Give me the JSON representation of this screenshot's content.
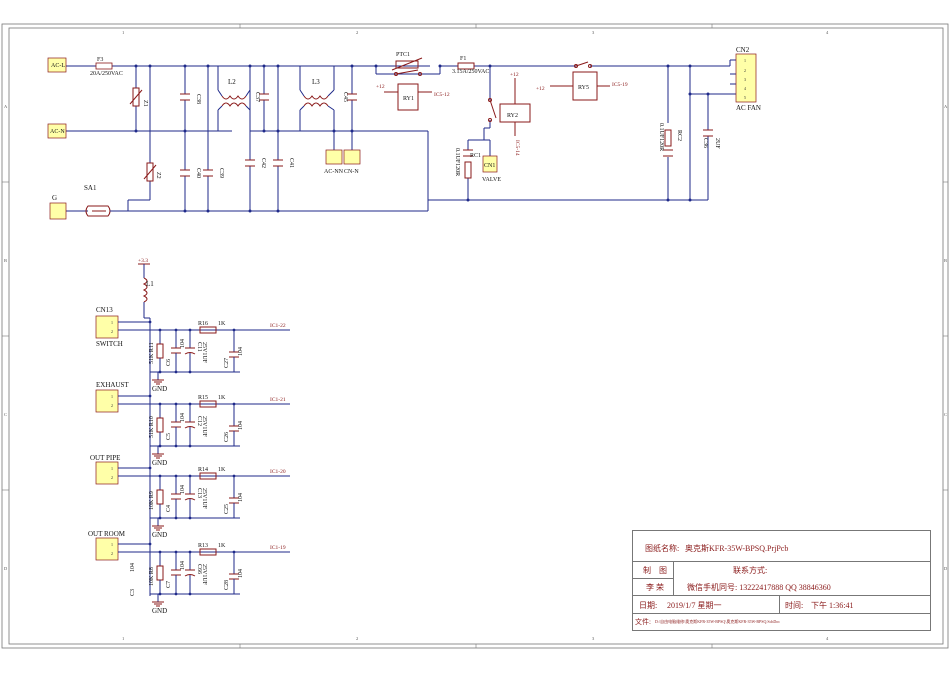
{
  "border": {
    "top_numbers": [
      "1",
      "2",
      "3",
      "4"
    ],
    "bottom_numbers": [
      "1",
      "2",
      "3",
      "4"
    ],
    "side_letters": [
      "A",
      "B",
      "C",
      "D"
    ]
  },
  "ac_section": {
    "terminals": {
      "ac_l": "AC-L",
      "ac_n": "AC-N",
      "g": "G"
    },
    "fuse_f3": {
      "ref": "F3",
      "value": "20A/250VAC"
    },
    "z1": "Z1",
    "z2": "Z2",
    "sa1": "SA1",
    "caps": {
      "c38": "C38",
      "c40": "C40",
      "c39": "C39",
      "c37": "C37",
      "c42": "C42",
      "c41": "C41",
      "c45": "C45"
    },
    "inductors": {
      "l2": "L2",
      "l3": "L3"
    },
    "out_terms": {
      "ac_nn": "AC-NN",
      "cn_n": "CN-N"
    },
    "ptc1": "PTC1",
    "fuse_f1": {
      "ref": "F1",
      "value": "3.15A/250VAC"
    },
    "ry1": {
      "ref": "RY1",
      "net": "IC5-12",
      "supply": "+12"
    },
    "ry2": {
      "ref": "RY2",
      "net": "IC5-14",
      "supply": "+12"
    },
    "ry5": {
      "ref": "RY5",
      "net": "IC5-19",
      "supply": "+12"
    },
    "rc1": {
      "ref": "RC1",
      "value": "0.1UF120R"
    },
    "cn1": {
      "ref": "CN1",
      "label": "VALVE"
    },
    "rc2": {
      "ref": "RC2",
      "value": "0.1UF120R"
    },
    "c36": {
      "ref": "C36",
      "value": "2UF"
    },
    "cn2": {
      "ref": "CN2",
      "label": "AC FAN",
      "pins": [
        "1",
        "2",
        "3",
        "4",
        "5"
      ]
    }
  },
  "input_section": {
    "supply": "+3.3",
    "l1": "L1",
    "gnd": "GND",
    "channels": [
      {
        "conn": "CN13",
        "name": "SWITCH",
        "pins": [
          "1",
          "2"
        ],
        "r_pull": "51K R11",
        "c_small": "C6",
        "c_small_val": "104",
        "c_elec": "C11",
        "c_elec_val": "25V1UF",
        "r_series": "R16",
        "r_series_val": "1K",
        "c_out": "C27",
        "c_out_val": "104",
        "net": "IC1-22"
      },
      {
        "conn": "",
        "name": "EXHAUST",
        "pins": [
          "1",
          "2"
        ],
        "r_pull": "51K R10",
        "c_small": "C5",
        "c_small_val": "104",
        "c_elec": "C12",
        "c_elec_val": "25V1UF",
        "r_series": "R15",
        "r_series_val": "1K",
        "c_out": "C26",
        "c_out_val": "104",
        "net": "IC1-21"
      },
      {
        "conn": "",
        "name": "OUT PIPE",
        "pins": [
          "1",
          "2"
        ],
        "r_pull": "10K R9",
        "c_small": "C4",
        "c_small_val": "104",
        "c_elec": "C13",
        "c_elec_val": "25V1UF",
        "r_series": "R14",
        "r_series_val": "1K",
        "c_out": "C25",
        "c_out_val": "104",
        "net": "IC1-20"
      },
      {
        "conn": "",
        "name": "OUT ROOM",
        "pins": [
          "1",
          "2"
        ],
        "r_pull": "10K R8",
        "c_small": "C7",
        "c_small_val": "104",
        "c_elec": "C66",
        "c_elec_val": "25V1UF",
        "r_series": "R13",
        "r_series_val": "1K",
        "c_out": "C28",
        "c_out_val": "104",
        "net": "IC1-19"
      }
    ],
    "c3": {
      "ref": "C3",
      "value": "104"
    }
  },
  "title_block": {
    "drawing_name_label": "图纸名称:",
    "drawing_name": "奥克斯KFR-35W-BPSQ.PrjPcb",
    "drawn_label": "制　图",
    "author": "李 荣",
    "contact_label": "联系方式:",
    "contact": "微信手机同号: 13222417888 QQ 38846360",
    "date_label": "日期:",
    "date": "2019/1/7 星期一",
    "time_label": "时间:",
    "time": "下午 1:36:41",
    "file_label": "文件:",
    "file": "D:\\自由电脑维修\\奥克斯KFR-35W-BPSQ\\奥克斯KFR-35W-BPSQ.SchDoc"
  }
}
